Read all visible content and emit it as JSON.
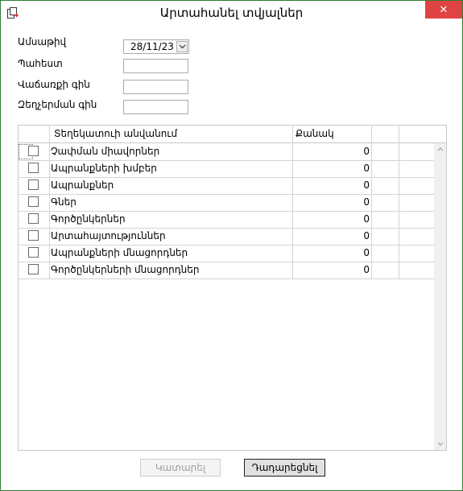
{
  "window": {
    "title": "Արտահանել տվյալներ",
    "close_glyph": "✕"
  },
  "form": {
    "date_label": "Ամսաթիվ",
    "date_value": "28/11/23",
    "warehouse_label": "Պահեստ",
    "warehouse_value": "",
    "sale_price_label": "Վաճառքի գին",
    "sale_price_value": "",
    "discount_price_label": "Զեղչերման գին",
    "discount_price_value": ""
  },
  "grid": {
    "columns": [
      "Տեղեկատուի անվանում",
      "Քանակ"
    ],
    "rows": [
      {
        "name": "Չափման միավորներ",
        "qty": "0",
        "checked": false
      },
      {
        "name": "Ապրանքների խմբեր",
        "qty": "0",
        "checked": false
      },
      {
        "name": "Ապրանքներ",
        "qty": "0",
        "checked": false
      },
      {
        "name": "Գներ",
        "qty": "0",
        "checked": false
      },
      {
        "name": "Գործընկերներ",
        "qty": "0",
        "checked": false
      },
      {
        "name": "Արտահայտություններ",
        "qty": "0",
        "checked": false
      },
      {
        "name": "Ապրանքների մնացորդներ",
        "qty": "0",
        "checked": false
      },
      {
        "name": "Գործընկերների մնացորդներ",
        "qty": "0",
        "checked": false
      }
    ]
  },
  "buttons": {
    "execute_label": "Կատարել",
    "cancel_label": "Դադարեցնել"
  },
  "colors": {
    "close_button": "#e04343",
    "window_border": "#2f7d32"
  },
  "icons": {
    "app": "export-icon",
    "date_dropdown": "chevron-down-icon"
  }
}
